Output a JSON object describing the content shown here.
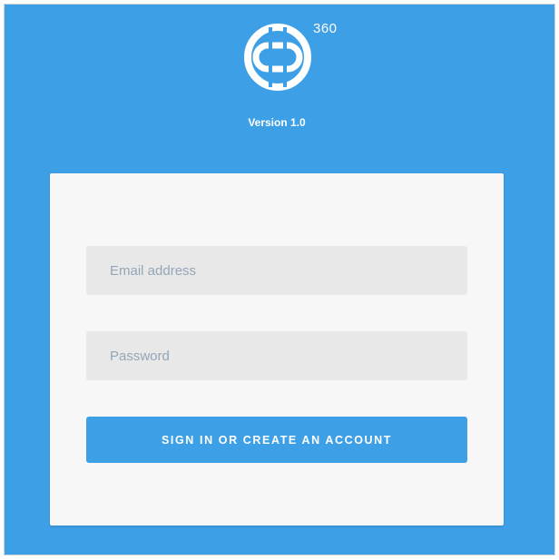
{
  "brand": {
    "logo_icon": "ring-logo-icon",
    "logo_suffix": "360",
    "version": "Version 1.0"
  },
  "login": {
    "email_placeholder": "Email address",
    "email_value": "",
    "password_placeholder": "Password",
    "password_value": "",
    "submit_label": "SIGN IN OR CREATE AN ACCOUNT"
  },
  "colors": {
    "background": "#3d9fe6",
    "accent": "#3d9fe6",
    "card": "#f7f7f7",
    "field": "#e8e8e8"
  }
}
